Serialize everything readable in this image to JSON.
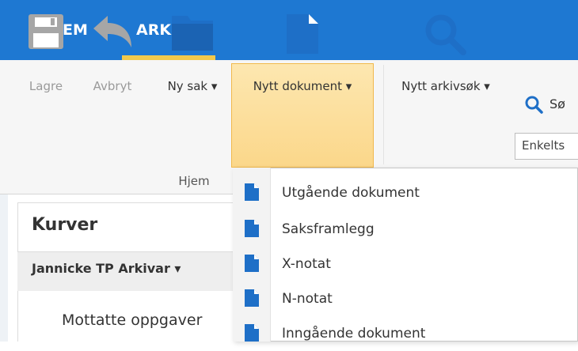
{
  "menu": {
    "tabs": [
      {
        "label": "HJEM"
      },
      {
        "label": "ARKIV"
      }
    ],
    "active_tab": "ARKIV",
    "accent_color": "#f2c94c",
    "bar_color": "#1e78d2"
  },
  "ribbon": {
    "buttons": [
      {
        "label": "Lagre",
        "icon": "save-icon",
        "enabled": false
      },
      {
        "label": "Avbryt",
        "icon": "undo-icon",
        "enabled": false
      },
      {
        "label": "Ny sak ▾",
        "icon": "folder-icon",
        "enabled": true
      },
      {
        "label": "Nytt dokument ▾",
        "icon": "document-icon",
        "enabled": true,
        "active": true
      },
      {
        "label": "Nytt arkivsøk ▾",
        "icon": "search-icon",
        "enabled": true
      }
    ],
    "group_label": "Hjem",
    "search_label": "Sø",
    "enkelt_placeholder": "Enkelts"
  },
  "panel": {
    "title": "Kurver",
    "user": "Jannicke TP Arkivar ▾",
    "item": "Mottatte oppgaver"
  },
  "dropdown": {
    "items": [
      {
        "label": "Utgående dokument",
        "icon": "document-icon"
      },
      {
        "label": "Saksframlegg",
        "icon": "document-icon"
      },
      {
        "label": "X-notat",
        "icon": "document-icon"
      },
      {
        "label": "N-notat",
        "icon": "document-icon"
      },
      {
        "label": "Inngående dokument",
        "icon": "document-icon"
      }
    ]
  },
  "colors": {
    "icon_blue": "#1e6fc7",
    "icon_gray": "#9a9a9a",
    "highlight": "#fbd78a"
  }
}
